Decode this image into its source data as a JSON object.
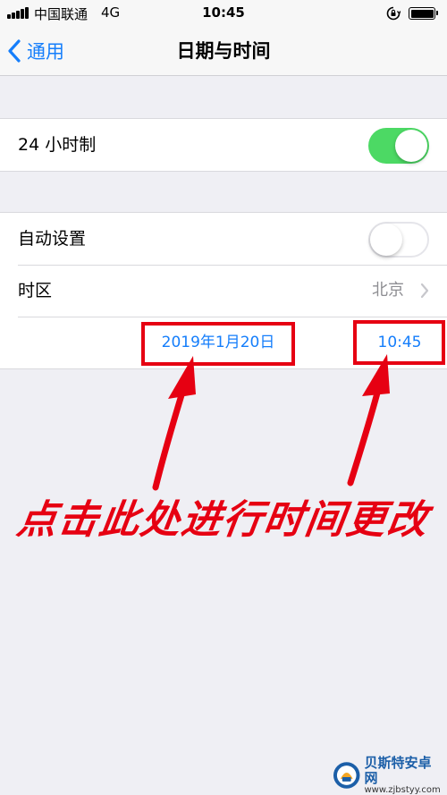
{
  "status_bar": {
    "carrier": "中国联通",
    "network": "4G",
    "time": "10:45",
    "icons": [
      "signal-icon",
      "orientation-lock-icon",
      "battery-icon"
    ]
  },
  "nav": {
    "back_label": "通用",
    "title": "日期与时间"
  },
  "settings": {
    "hour24": {
      "label": "24 小时制",
      "enabled": true
    },
    "auto_set": {
      "label": "自动设置",
      "enabled": false
    },
    "timezone": {
      "label": "时区",
      "value": "北京"
    },
    "date_value": "2019年1月20日",
    "time_value": "10:45"
  },
  "annotation": {
    "text": "点击此处进行时间更改",
    "color": "#e60012"
  },
  "watermark": {
    "name": "贝斯特安卓网",
    "url": "www.zjbstyy.com"
  },
  "colors": {
    "accent": "#157efb",
    "toggle_on": "#4cd964",
    "background": "#efeff4",
    "secondary_text": "#8e8e93"
  }
}
